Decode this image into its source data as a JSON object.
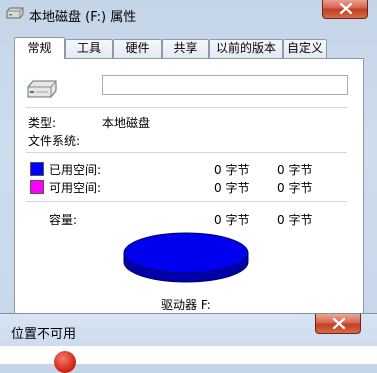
{
  "window": {
    "title": "本地磁盘 (F:) 属性",
    "close_label": "Close"
  },
  "tabs": [
    {
      "label": "常规",
      "active": true
    },
    {
      "label": "工具",
      "active": false
    },
    {
      "label": "硬件",
      "active": false
    },
    {
      "label": "共享",
      "active": false
    },
    {
      "label": "以前的版本",
      "active": false
    },
    {
      "label": "自定义",
      "active": false
    }
  ],
  "general": {
    "name_value": "",
    "type_label": "类型:",
    "type_value": "本地磁盘",
    "fs_label": "文件系统:",
    "fs_value": "",
    "used": {
      "label": "已用空间:",
      "bytes": "0 字节",
      "size": "0 字节",
      "color": "#0000ff"
    },
    "free": {
      "label": "可用空间:",
      "bytes": "0 字节",
      "size": "0 字节",
      "color": "#ff00ff"
    },
    "capacity": {
      "label": "容量:",
      "bytes": "0 字节",
      "size": "0 字节"
    },
    "drive_label": "驱动器 F:",
    "pie_color": "#0000ee"
  },
  "error_dialog": {
    "title": "位置不可用"
  }
}
